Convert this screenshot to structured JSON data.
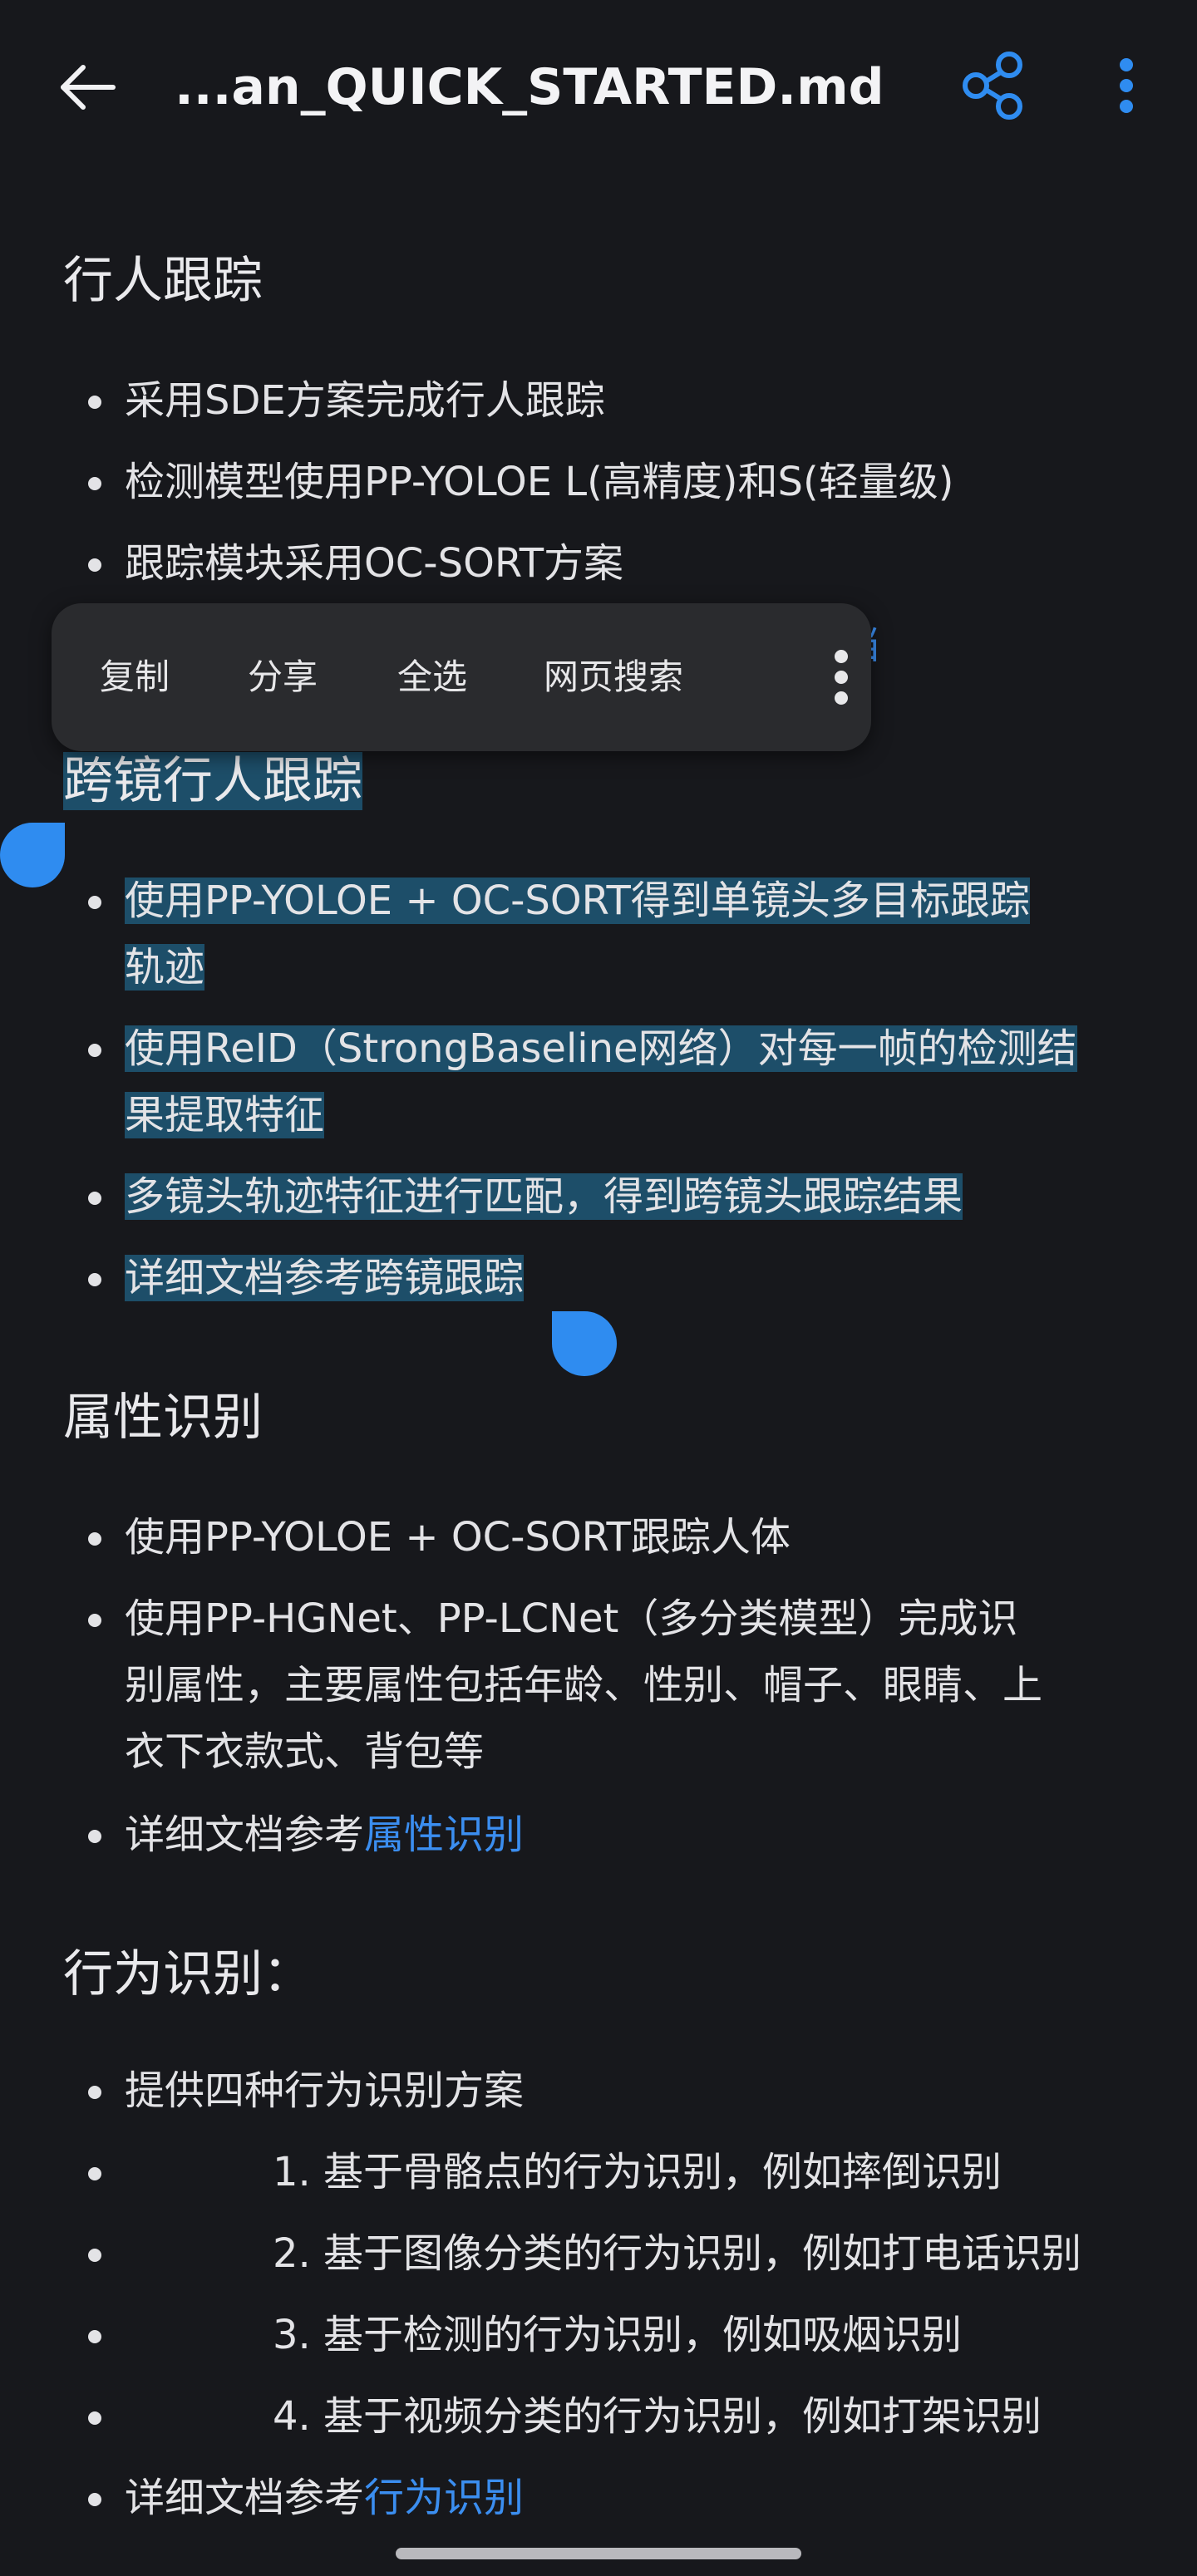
{
  "appbar": {
    "title": "...an_QUICK_STARTED.md",
    "accent_color": "#2f8cf0",
    "back_icon": "arrow-left-icon",
    "share_icon": "share-icon",
    "more_icon": "more-vert-icon"
  },
  "sections": {
    "s1": {
      "title": "行人跟踪",
      "items": [
        "采用SDE方案完成行人跟踪",
        "检测模型使用PP-YOLOE L(高精度)和S(轻量级)",
        "跟踪模块采用OC-SORT方案"
      ],
      "hidden_link_fragment": "档"
    },
    "s2": {
      "title": "跨镜行人跟踪",
      "items": [
        [
          "使用PP-YOLOE + OC-SORT得到单镜头多目标跟踪",
          "轨迹"
        ],
        [
          "使用ReID（StrongBaseline网络）对每一帧的检测结",
          "果提取特征"
        ],
        [
          "多镜头轨迹特征进行匹配，得到跨镜头跟踪结果"
        ],
        [
          "详细文档参考跨镜跟踪"
        ]
      ]
    },
    "s3": {
      "title": "属性识别",
      "item1": "使用PP-YOLOE + OC-SORT跟踪人体",
      "item2": [
        "使用PP-HGNet、PP-LCNet（多分类模型）完成识",
        "别属性，主要属性包括年龄、性别、帽子、眼睛、上",
        "衣下衣款式、背包等"
      ],
      "item3_prefix": "详细文档参考",
      "item3_link": "属性识别"
    },
    "s4": {
      "title": "行为识别：",
      "item1": "提供四种行为识别方案",
      "sub": [
        "1. 基于骨骼点的行为识别，例如摔倒识别",
        "2. 基于图像分类的行为识别，例如打电话识别",
        "3. 基于检测的行为识别，例如吸烟识别",
        "4. 基于视频分类的行为识别，例如打架识别"
      ],
      "last_prefix": "详细文档参考",
      "last_link": "行为识别"
    }
  },
  "context_menu": {
    "copy": "复制",
    "share": "分享",
    "select_all": "全选",
    "web_search": "网页搜索",
    "more_icon": "more-vert-icon"
  },
  "colors": {
    "background": "#17181c",
    "link": "#3b8ef0",
    "selection": "#1d4e69",
    "handle": "#2f8cf0"
  }
}
